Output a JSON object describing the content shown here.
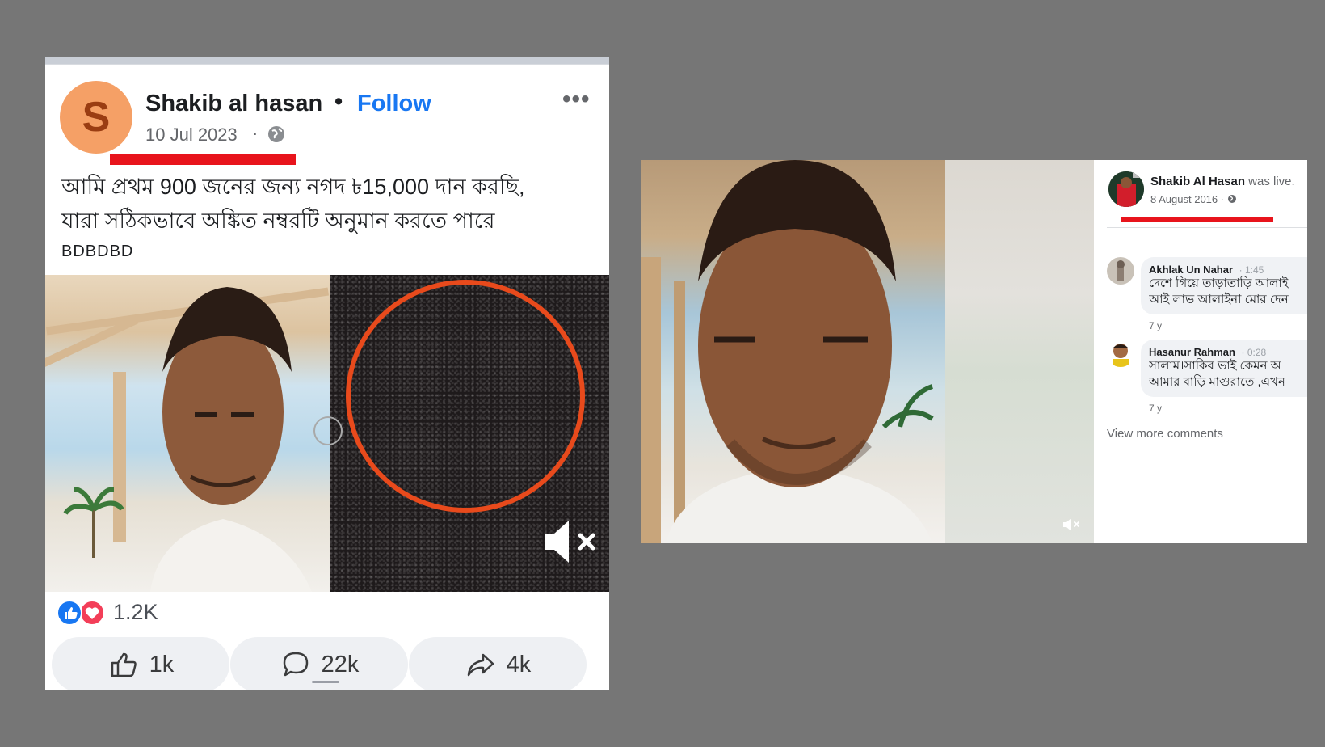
{
  "left_post": {
    "avatar_letter": "S",
    "author": "Shakib al hasan",
    "separator": "•",
    "follow_label": "Follow",
    "more_label": "•••",
    "date": "10 Jul 2023",
    "date_separator": "·",
    "privacy_icon": "globe-icon",
    "body_line1": "আমি প্রথম 900 জনের জন্য নগদ ৳15,000 দান করছি,",
    "body_line2": "যারা সঠিকভাবে অঙ্কিত নম্বরটি অনুমান করতে পারে",
    "tag": "BDBDBD",
    "reactions": {
      "icons": [
        "like-icon",
        "love-icon"
      ],
      "count": "1.2K"
    },
    "actions": [
      {
        "icon": "thumb-up-icon",
        "count": "1k"
      },
      {
        "icon": "comment-icon",
        "count": "22k"
      },
      {
        "icon": "share-icon",
        "count": "4k"
      }
    ]
  },
  "right_post": {
    "author": "Shakib Al Hasan",
    "status": "was live.",
    "date": "8 August 2016 ·",
    "privacy_icon": "globe-icon",
    "comments": [
      {
        "author": "Akhlak Un Nahar",
        "time": "· 1:45",
        "line1": "দেশে গিয়ে তাড়াতাড়ি আলাই",
        "line2": "আই লাভ আলাইনা মোর দেন",
        "age": "7 y"
      },
      {
        "author": "Hasanur Rahman",
        "time": "· 0:28",
        "line1": "সালাম।সাকিব ভাই কেমন অ",
        "line2": "আমার বাড়ি মাগুরাতে ,এখন",
        "age": "7 y"
      }
    ],
    "view_more": "View more comments"
  },
  "colors": {
    "background": "#767676",
    "facebook_blue": "#1877f2",
    "highlight_red": "#e8141c",
    "circle_annotation": "#e84a1c"
  }
}
